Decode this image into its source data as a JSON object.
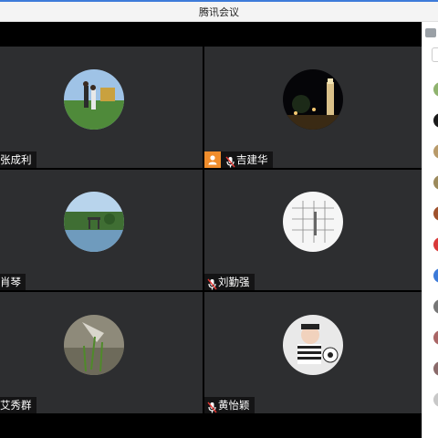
{
  "window": {
    "title": "腾讯会议"
  },
  "participants": [
    {
      "name": "张成利",
      "avatar": "landscape-photo-avatar",
      "mic": false,
      "user_badge": false
    },
    {
      "name": "吉建华",
      "avatar": "night-tower-avatar",
      "mic": true,
      "user_badge": true
    },
    {
      "name": "肖琴",
      "avatar": "pavilion-lake-avatar",
      "mic": false,
      "user_badge": false
    },
    {
      "name": "刘勤强",
      "avatar": "grid-sketch-avatar",
      "mic": true,
      "user_badge": false
    },
    {
      "name": "艾秀群",
      "avatar": "grass-closeup-avatar",
      "mic": false,
      "user_badge": false
    },
    {
      "name": "黄怡颖",
      "avatar": "baby-football-avatar",
      "mic": true,
      "user_badge": false
    }
  ],
  "colors": {
    "tile_bg": "#2d2e30",
    "accent": "#3d7bd9",
    "badge": "#f08d2c"
  }
}
